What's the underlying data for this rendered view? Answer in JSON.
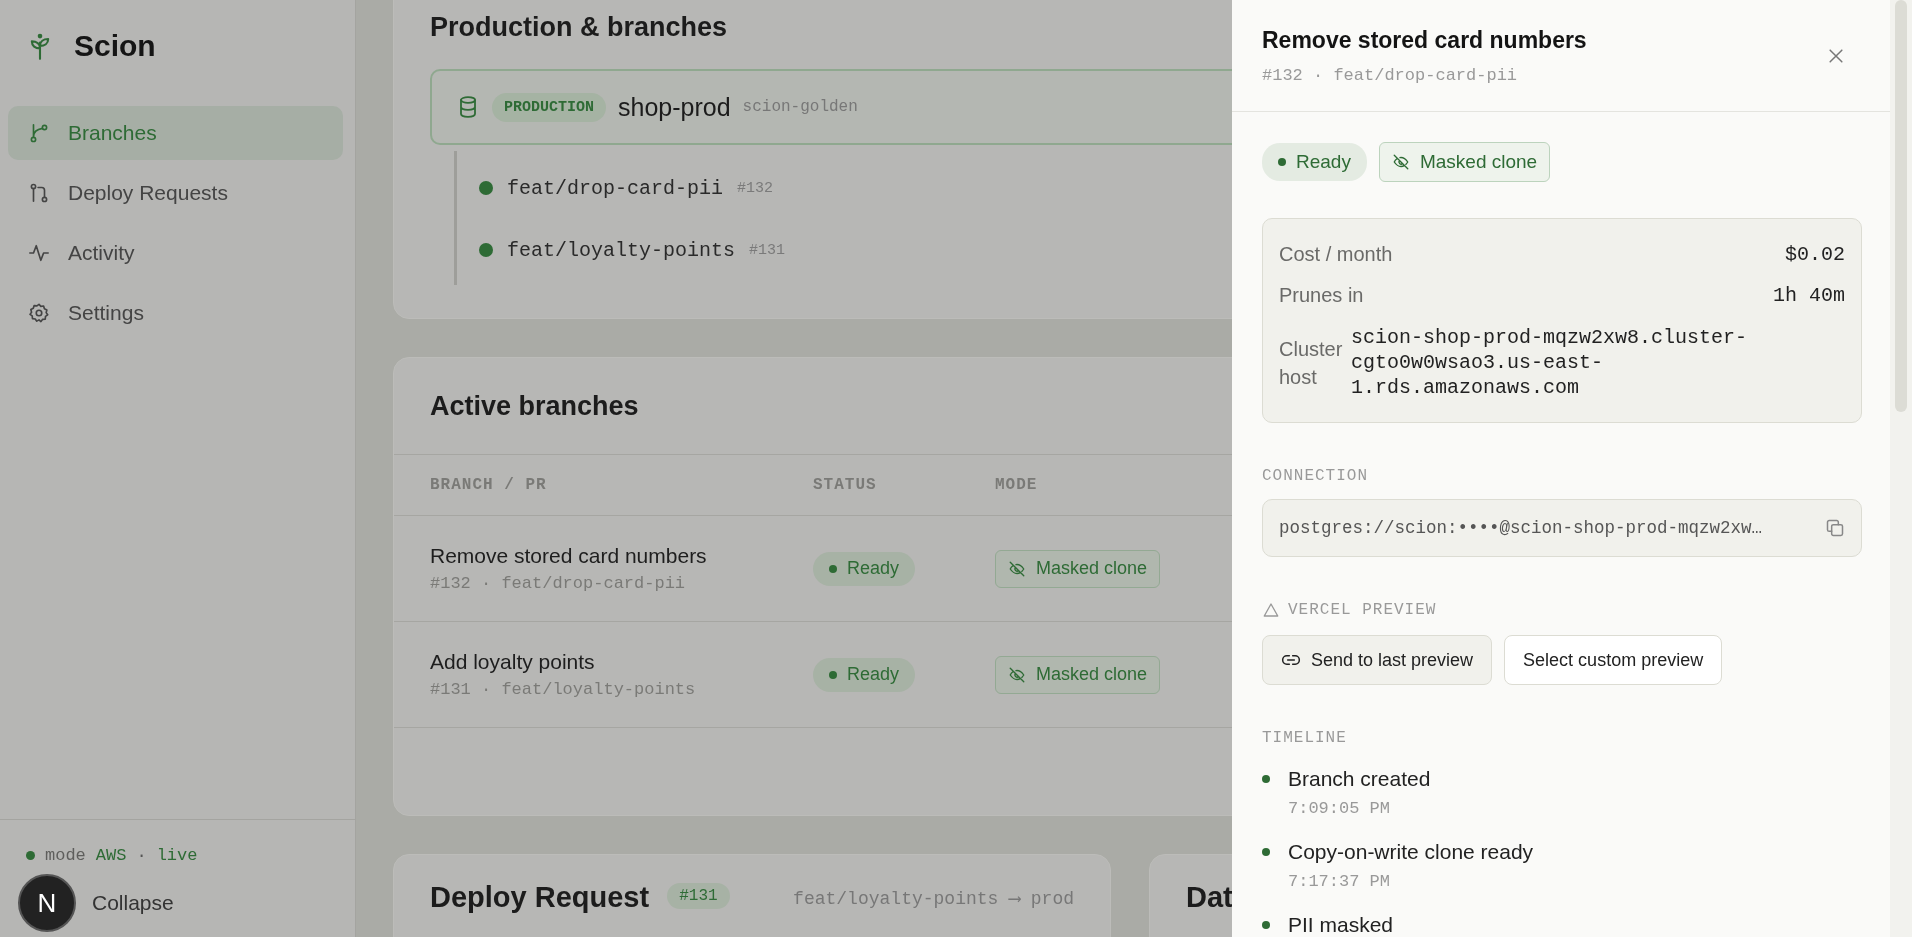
{
  "sidebar": {
    "logo": "Scion",
    "nav": [
      {
        "label": "Branches",
        "kind": "branch",
        "selected": true
      },
      {
        "label": "Deploy Requests",
        "kind": "pull-request",
        "selected": false
      },
      {
        "label": "Activity",
        "kind": "activity",
        "selected": false
      },
      {
        "label": "Settings",
        "kind": "settings",
        "selected": false
      }
    ],
    "footer": {
      "mode_label": "mode",
      "mode_value": "AWS",
      "separator": "·",
      "live": "live",
      "collapse": "Collapse"
    }
  },
  "dev_indicator": {
    "label": "N"
  },
  "production_card": {
    "title": "Production & branches",
    "production": {
      "badge": "PRODUCTION",
      "name": "shop-prod",
      "source": "scion-golden"
    },
    "branches": [
      {
        "name": "feat/drop-card-pii",
        "pr": "#132"
      },
      {
        "name": "feat/loyalty-points",
        "pr": "#131"
      }
    ]
  },
  "active_branches": {
    "title": "Active branches",
    "columns": [
      "BRANCH / PR",
      "STATUS",
      "MODE"
    ],
    "rows": [
      {
        "title": "Remove stored card numbers",
        "meta": "#132 · feat/drop-card-pii",
        "status": "Ready",
        "mode": "Masked clone"
      },
      {
        "title": "Add loyalty points",
        "meta": "#131 · feat/loyalty-points",
        "status": "Ready",
        "mode": "Masked clone"
      }
    ]
  },
  "deploy_request": {
    "title": "Deploy Request",
    "pr": "#131",
    "route": "feat/loyalty-points ⟶ prod"
  },
  "card_4": {
    "title": "Dat"
  },
  "drawer": {
    "title": "Remove stored card numbers",
    "subtitle": "#132 · feat/drop-card-pii",
    "status": "Ready",
    "mode": "Masked clone",
    "details": [
      {
        "label": "Cost / month",
        "value": "$0.02",
        "kind": "inline"
      },
      {
        "label": "Prunes in",
        "value": "1h 40m",
        "kind": "inline"
      },
      {
        "label": "Cluster host",
        "value": "scion-shop-prod-mqzw2xw8.cluster-cgto0w0wsao3.us-east-1.rds.amazonaws.com",
        "kind": "multiline"
      }
    ],
    "connection": {
      "label": "CONNECTION",
      "value": "postgres://scion:••••@scion-shop-prod-mqzw2xw…"
    },
    "vercel": {
      "label": "VERCEL PREVIEW",
      "buttons": [
        {
          "label": "Send to last preview",
          "kind": "primary"
        },
        {
          "label": "Select custom preview",
          "kind": "secondary"
        }
      ]
    },
    "timeline": {
      "label": "TIMELINE",
      "events": [
        {
          "title": "Branch created",
          "time": "7:09:05 PM"
        },
        {
          "title": "Copy-on-write clone ready",
          "time": "7:17:37 PM"
        },
        {
          "title": "PII masked"
        }
      ]
    }
  }
}
